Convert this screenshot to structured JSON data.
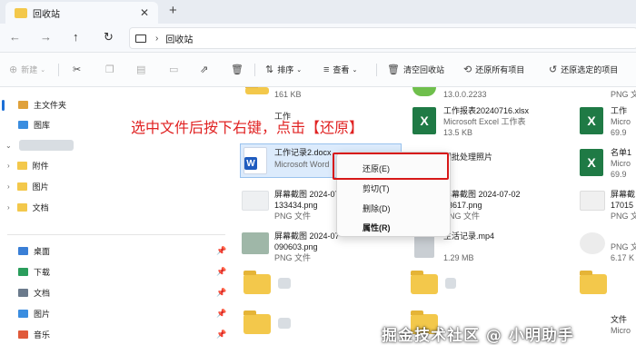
{
  "window": {
    "tab_title": "回收站",
    "close_glyph": "✕",
    "newtab_glyph": "+"
  },
  "address": {
    "breadcrumb": "回收站",
    "separator": "›"
  },
  "toolbar": {
    "new_label": "新建",
    "sort_label": "排序",
    "view_label": "查看",
    "empty_bin_label": "清空回收站",
    "restore_all_label": "还原所有项目",
    "restore_selected_label": "还原选定的项目",
    "more_label": "···"
  },
  "sidebar": {
    "home": "主文件夹",
    "gallery": "图库",
    "folders": [
      "附件",
      "图片",
      "文档"
    ],
    "quick_access": [
      "桌面",
      "下载",
      "文档",
      "图片",
      "音乐"
    ]
  },
  "files": {
    "col1": [
      {
        "name": "",
        "meta": "161 KB"
      },
      {
        "name": "工作",
        "meta": ""
      },
      {
        "name": "工作记录2.docx",
        "meta": "Microsoft Word"
      },
      {
        "name": "屏幕截图 2024-07",
        "meta": "133434.png",
        "meta2": "PNG 文件"
      },
      {
        "name": "屏幕截图 2024-07",
        "meta": "090603.png",
        "meta2": "PNG 文件"
      }
    ],
    "col2": [
      {
        "name": "",
        "meta": "13.0.0.2233"
      },
      {
        "name": "工作报表20240716.xlsx",
        "meta": "Microsoft Excel 工作表",
        "meta2": "13.5 KB"
      },
      {
        "name": "图批处理照片",
        "meta": ""
      },
      {
        "name": "屏幕截图 2024-07-02",
        "meta": "53617.png",
        "meta2": "PNG 文件"
      },
      {
        "name": "生活记录.mp4",
        "meta": "",
        "meta2": "1.29 MB"
      }
    ],
    "col3": [
      {
        "name": "",
        "meta": "PNG 文件"
      },
      {
        "name": "工作",
        "meta": "Micro",
        "meta2": "69.9"
      },
      {
        "name": "名单1",
        "meta": "Micro",
        "meta2": "69.9"
      },
      {
        "name": "屏幕截",
        "meta": "17015",
        "meta2": "PNG 文"
      },
      {
        "name": "",
        "meta": "PNG 文",
        "meta2": "6.17 K"
      },
      {
        "name": "文件",
        "meta": "Micro"
      }
    ]
  },
  "context_menu": {
    "items": [
      "还原(E)",
      "剪切(T)",
      "删除(D)",
      "属性(R)"
    ]
  },
  "annotation": "选中文件后按下右键，点击【还原】",
  "watermark": "掘金技术社区 @ 小明助手",
  "colors": {
    "accent": "#1c6fd6",
    "highlight_box": "#d71818",
    "annotation": "#e02222",
    "selection": "#dcebfc"
  }
}
